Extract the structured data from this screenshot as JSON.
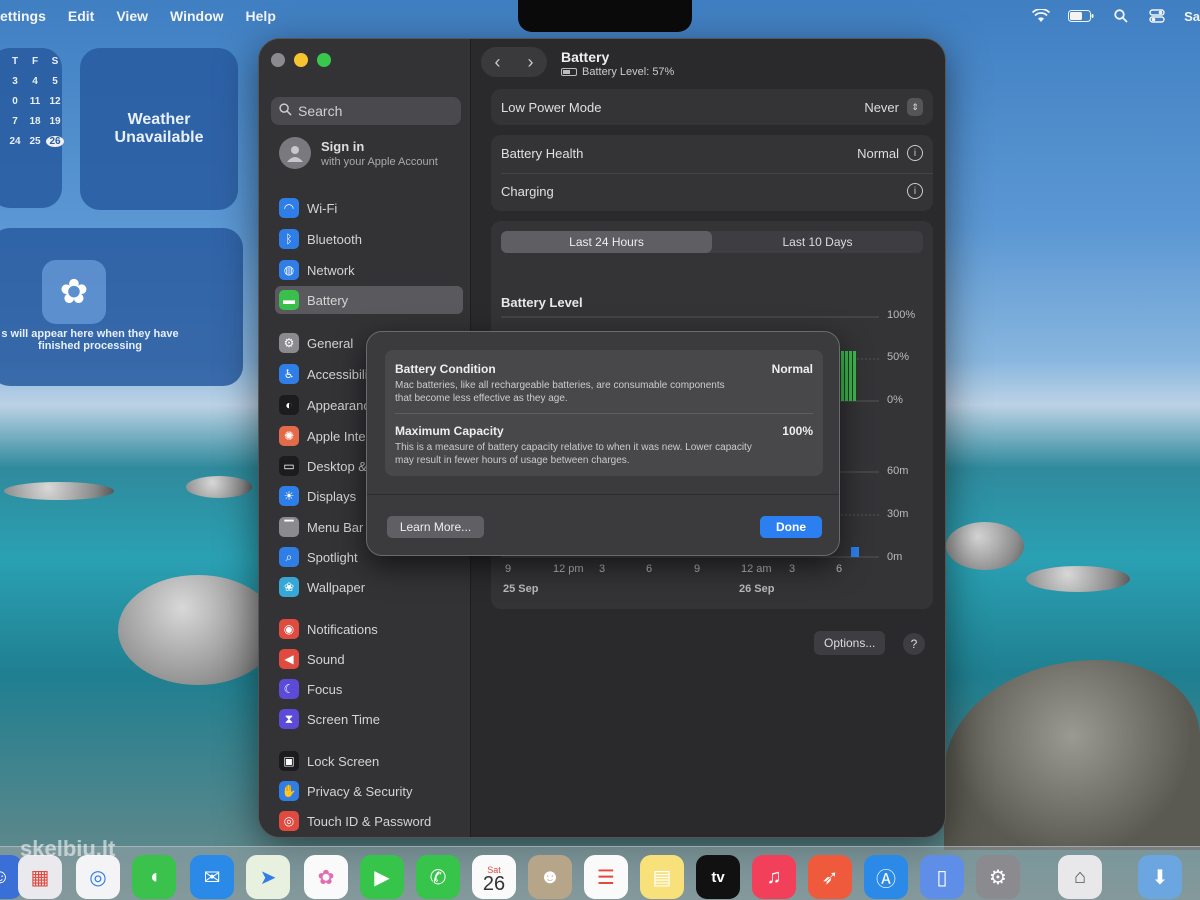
{
  "menubar": {
    "items": [
      "ettings",
      "Edit",
      "View",
      "Window",
      "Help"
    ],
    "right_text": "Sa"
  },
  "widgets": {
    "calendar": {
      "rows": [
        [
          "T",
          "F",
          "S"
        ],
        [
          "3",
          "4",
          "5"
        ],
        [
          "0",
          "11",
          "12"
        ],
        [
          "7",
          "18",
          "19"
        ],
        [
          "24",
          "25",
          "26"
        ]
      ],
      "today": "26"
    },
    "weather": {
      "line1": "Weather",
      "line2": "Unavailable"
    },
    "photos": {
      "line1": "s will appear here when they have",
      "line2": "finished processing"
    }
  },
  "sidebar": {
    "search_placeholder": "Search",
    "signin_title": "Sign in",
    "signin_sub": "with your Apple Account",
    "items": [
      {
        "label": "Wi-Fi",
        "icon": "wifi-icon",
        "color": "#2f7ee8"
      },
      {
        "label": "Bluetooth",
        "icon": "bluetooth-icon",
        "color": "#2f7ee8"
      },
      {
        "label": "Network",
        "icon": "globe-icon",
        "color": "#2f7ee8"
      },
      {
        "label": "Battery",
        "icon": "battery-icon",
        "color": "#3bbf4c"
      },
      {
        "label": "General",
        "icon": "gear-icon",
        "color": "#8a8a8f"
      },
      {
        "label": "Accessibili",
        "icon": "accessibility-icon",
        "color": "#2f7ee8"
      },
      {
        "label": "Appearanc",
        "icon": "appearance-icon",
        "color": "#1c1c1e"
      },
      {
        "label": "Apple Inte",
        "icon": "apple-intelligence-icon",
        "color": "#e36b4a"
      },
      {
        "label": "Desktop &",
        "icon": "desktop-icon",
        "color": "#1c1c1e"
      },
      {
        "label": "Displays",
        "icon": "displays-icon",
        "color": "#2f7ee8"
      },
      {
        "label": "Menu Bar",
        "icon": "menubar-icon",
        "color": "#8a8a8f"
      },
      {
        "label": "Spotlight",
        "icon": "spotlight-icon",
        "color": "#2f7ee8"
      },
      {
        "label": "Wallpaper",
        "icon": "wallpaper-icon",
        "color": "#35a8d8"
      },
      {
        "label": "Notifications",
        "icon": "bell-icon",
        "color": "#e04a3f"
      },
      {
        "label": "Sound",
        "icon": "speaker-icon",
        "color": "#e04a3f"
      },
      {
        "label": "Focus",
        "icon": "moon-icon",
        "color": "#5b4bd8"
      },
      {
        "label": "Screen Time",
        "icon": "hourglass-icon",
        "color": "#5b4bd8"
      },
      {
        "label": "Lock Screen",
        "icon": "lock-icon",
        "color": "#1c1c1e"
      },
      {
        "label": "Privacy & Security",
        "icon": "hand-icon",
        "color": "#2f7ee8"
      },
      {
        "label": "Touch ID & Password",
        "icon": "fingerprint-icon",
        "color": "#e04a3f"
      }
    ]
  },
  "header": {
    "title": "Battery",
    "subtitle": "Battery Level: 57%"
  },
  "settings": {
    "low_power_label": "Low Power Mode",
    "low_power_value": "Never",
    "health_label": "Battery Health",
    "health_value": "Normal",
    "charging_label": "Charging"
  },
  "usage": {
    "tabs": [
      "Last 24 Hours",
      "Last 10 Days"
    ],
    "chart_title": "Battery Level",
    "level_ticks": [
      "100%",
      "50%",
      "0%"
    ],
    "time_ticks": [
      "60m",
      "30m",
      "0m"
    ],
    "x_ticks": [
      "9",
      "12 pm",
      "3",
      "6",
      "9",
      "12 am",
      "3",
      "6"
    ],
    "x_dates": [
      "25 Sep",
      "26 Sep"
    ],
    "options_label": "Options...",
    "help_label": "?"
  },
  "dialog": {
    "condition_title": "Battery Condition",
    "condition_value": "Normal",
    "condition_desc": "Mac batteries, like all rechargeable batteries, are consumable components that become less effective as they age.",
    "capacity_title": "Maximum Capacity",
    "capacity_value": "100%",
    "capacity_desc": "This is a measure of battery capacity relative to when it was new. Lower capacity may result in fewer hours of usage between charges.",
    "learn_more": "Learn More...",
    "done": "Done"
  },
  "dock": {
    "calendar_day": "Sat",
    "calendar_date": "26",
    "tv_label": "tv",
    "watermark": "skelbiu.lt"
  },
  "colors": {
    "accent": "#2b7ff0",
    "battery_green": "#3bbf4c"
  }
}
